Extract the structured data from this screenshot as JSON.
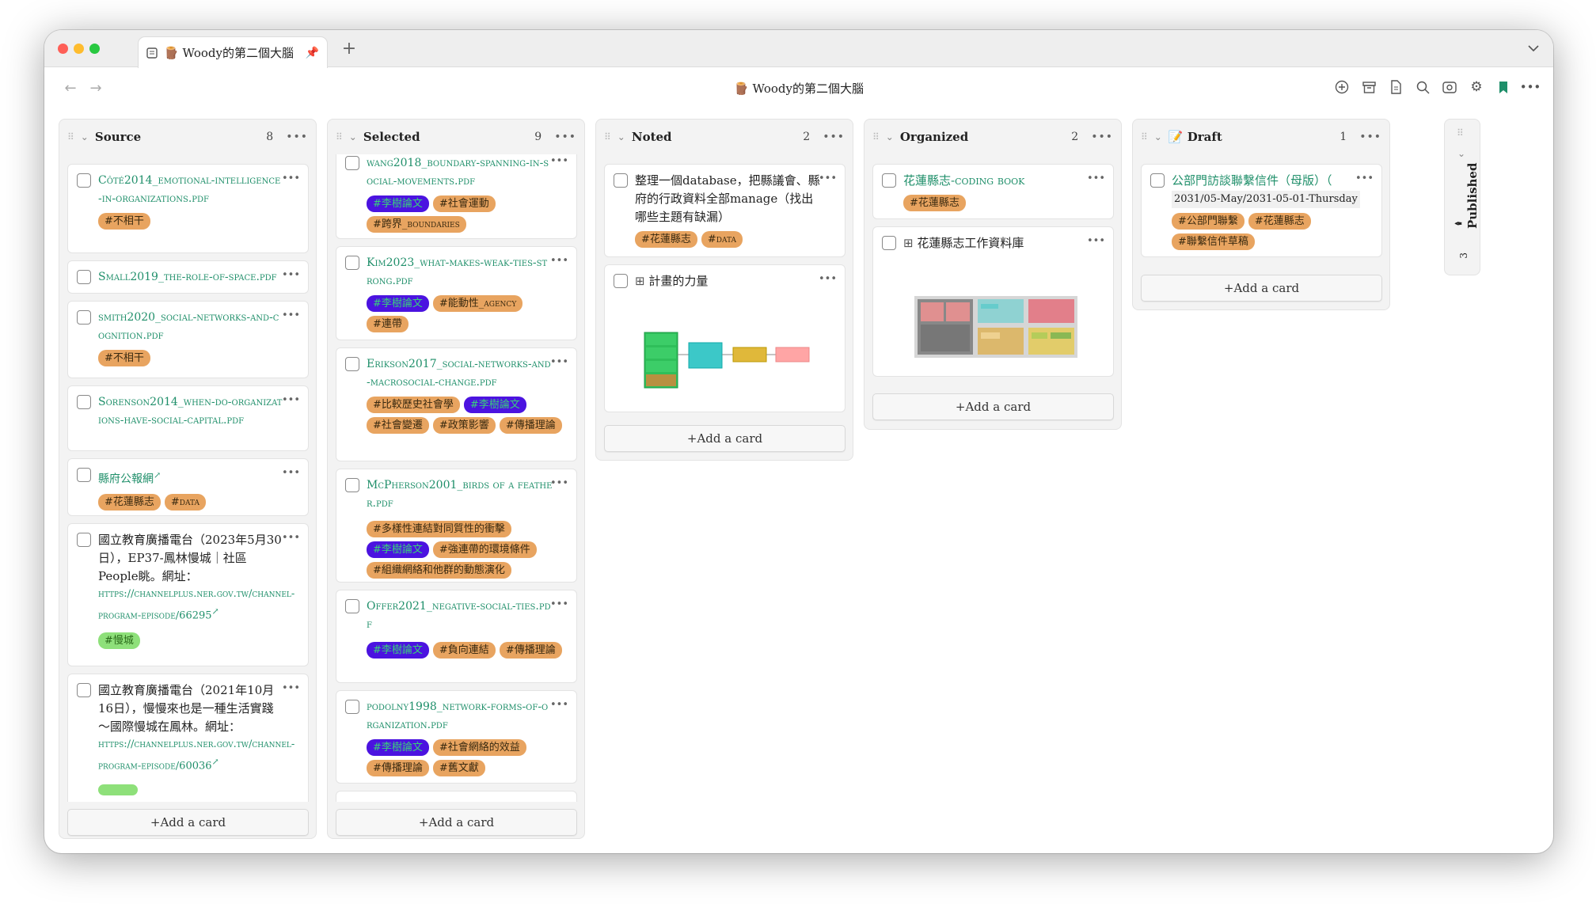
{
  "tab": {
    "title": "🪵 Woody的第二個大腦"
  },
  "window": {
    "title": "🪵 Woody的第二個大腦"
  },
  "lanes": [
    {
      "name": "Source",
      "count": "8",
      "add": "+Add a card"
    },
    {
      "name": "Selected",
      "count": "9",
      "add": "+Add a card"
    },
    {
      "name": "Noted",
      "count": "2",
      "add": "+Add a card"
    },
    {
      "name": "Organized",
      "count": "2",
      "add": "+Add a card"
    },
    {
      "name": "📝 Draft",
      "count": "1",
      "add": "+Add a card"
    }
  ],
  "collapsed_lane": {
    "name": "Published",
    "count": "3"
  },
  "source_cards": [
    {
      "link": "Côté2014_emotional-intelligence-in-organizations.pdf",
      "tags": [
        "#不相干"
      ]
    },
    {
      "link": "Small2019_the-role-of-space.pdf",
      "tags": []
    },
    {
      "link": "smith2020_social-networks-and-cognition.pdf",
      "tags": [
        "#不相干"
      ]
    },
    {
      "link": "Sorenson2014_when-do-organizations-have-social-capital.pdf",
      "tags": []
    },
    {
      "link": "縣府公報網",
      "tags": [
        "#花蓮縣志",
        "#data"
      ]
    },
    {
      "text": "國立教育廣播電台（2023年5月30日），EP37-鳳林慢城｜社區People眺。網址：",
      "url": "https://channelplus.ner.gov.tw/channel-program-episode/66295",
      "tags": [
        "#慢城"
      ]
    },
    {
      "text": "國立教育廣播電台（2021年10月16日），慢慢來也是一種生活實踐～國際慢城在鳳林。網址：",
      "url": "https://channelplus.ner.gov.tw/channel-program-episode/60036",
      "tags": []
    }
  ],
  "selected_cards": [
    {
      "link": "wang2018_boundary-spanning-in-social-movements.pdf",
      "tags": [
        "#李樹論文",
        "#社會運動",
        "#跨界_boundaries"
      ]
    },
    {
      "link": "Kim2023_what-makes-weak-ties-strong.pdf",
      "tags": [
        "#李樹論文",
        "#能動性_agency",
        "#連帶"
      ]
    },
    {
      "link": "Erikson2017_social-networks-and-macrosocial-change.pdf",
      "tags": [
        "#比較歷史社會學",
        "#李樹論文",
        "#社會變遷",
        "#政策影響",
        "#傳播理論"
      ]
    },
    {
      "link": "McPherson2001_birds of a feather.pdf",
      "tags": [
        "#多樣性連結對同質性的衝擊",
        "#李樹論文",
        "#強連帶的環境條件",
        "#組織網絡和他群的動態演化"
      ]
    },
    {
      "link": "Offer2021_negative-social-ties.pdf",
      "tags": [
        "#李樹論文",
        "#負向連結",
        "#傳播理論"
      ]
    },
    {
      "link": "podolny1998_network-forms-of-organization.pdf",
      "tags": [
        "#李樹論文",
        "#社會網絡的效益",
        "#傳播理論",
        "#舊文獻"
      ]
    }
  ],
  "noted_cards": [
    {
      "text": "整理一個database，把縣議會、縣府的行政資料全部manage（找出哪些主題有缺漏）",
      "tags": [
        "#花蓮縣志",
        "#data"
      ]
    },
    {
      "text": "計畫的力量",
      "icon": "board-icon"
    }
  ],
  "organized_cards": [
    {
      "link": "花蓮縣志-coding book",
      "tags": [
        "#花蓮縣志"
      ]
    },
    {
      "text": "花蓮縣志工作資料庫",
      "icon": "board-icon"
    }
  ],
  "draft_cards": [
    {
      "link": "公部門訪談聯繫信件（母版）（",
      "sub": "2031/05-May/2031-05-01-Thursday",
      "tags": [
        "#公部門聯繫",
        "#花蓮縣志",
        "#聯繫信件草稿"
      ]
    }
  ]
}
